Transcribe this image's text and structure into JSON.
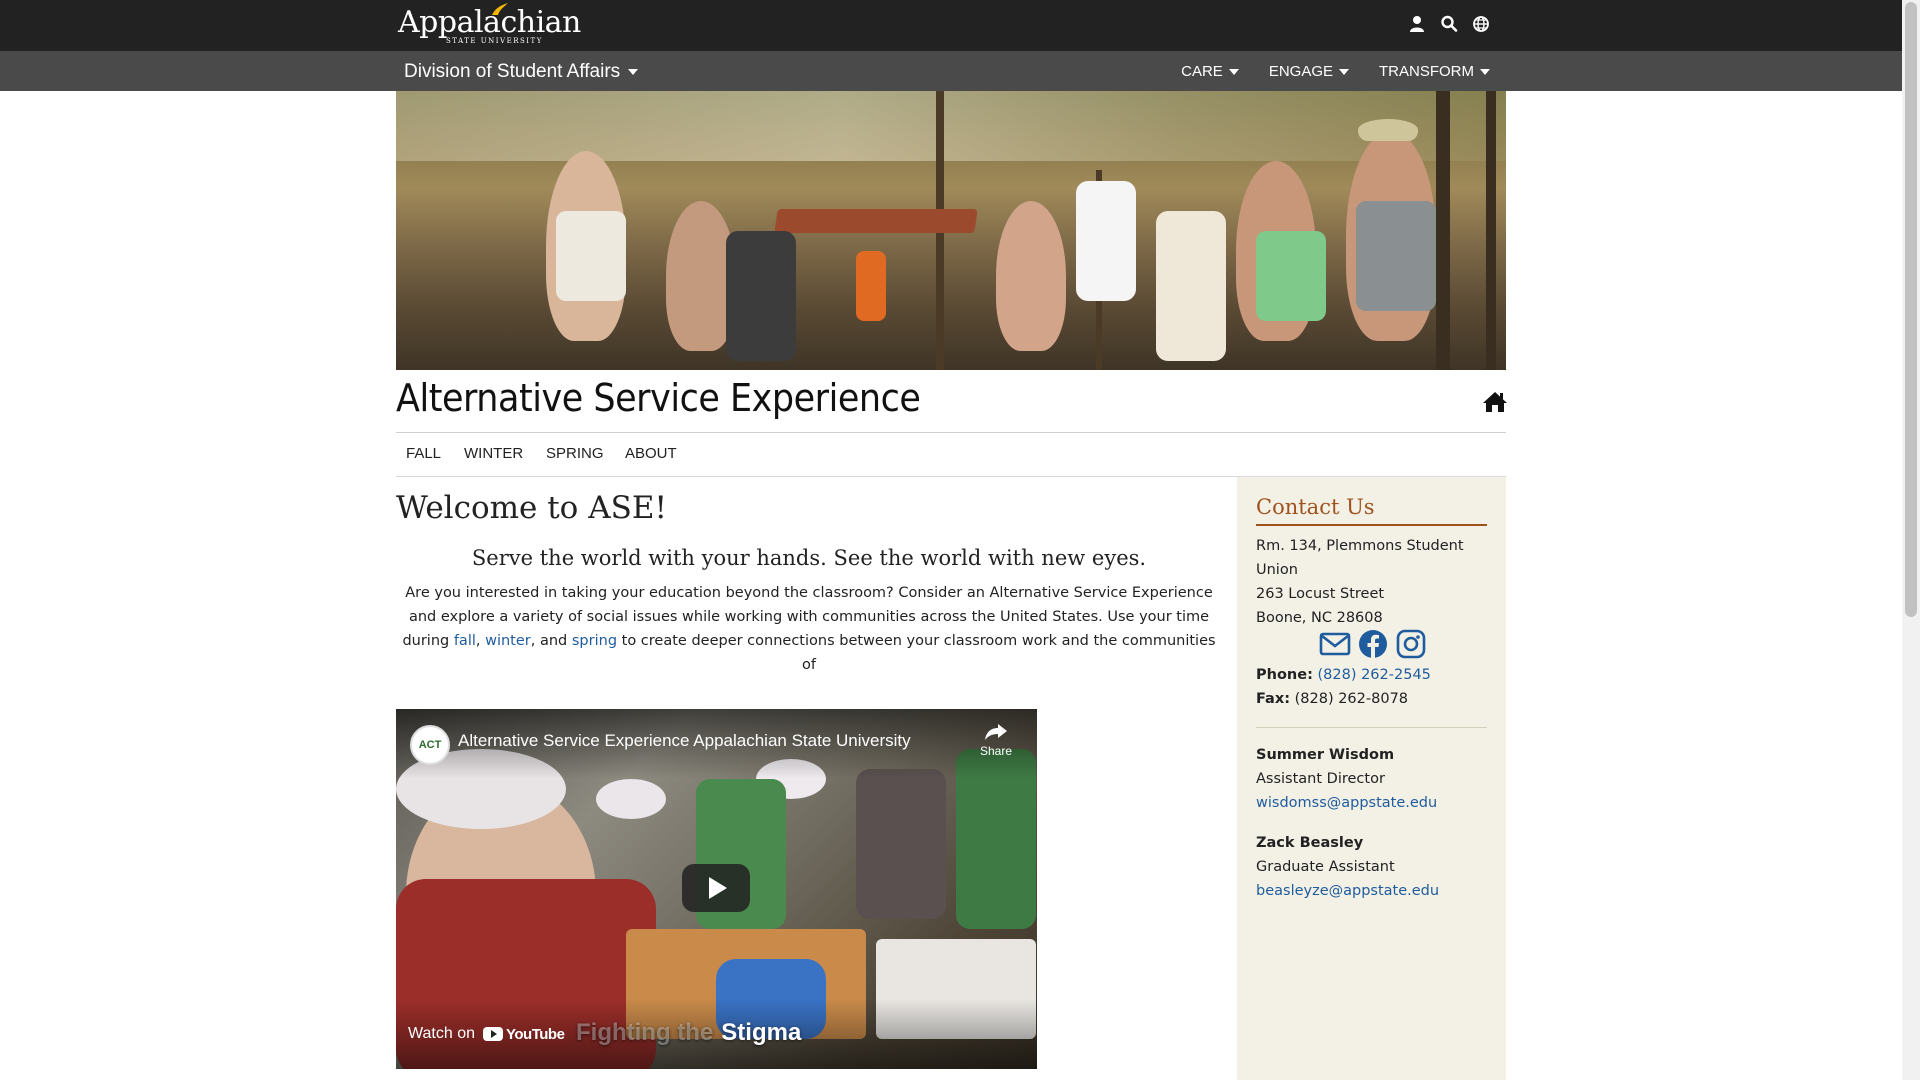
{
  "header": {
    "logo_text": "Appalachian",
    "logo_sub": "STATE UNIVERSITY",
    "icons": [
      "user-icon",
      "search-icon",
      "globe-icon"
    ]
  },
  "division_nav": {
    "title": "Division of Student Affairs",
    "menu": [
      "CARE",
      "ENGAGE",
      "TRANSFORM"
    ]
  },
  "site": {
    "title": "Alternative Service Experience",
    "subnav": [
      "FALL",
      "WINTER",
      "SPRING",
      "ABOUT"
    ]
  },
  "main": {
    "welcome": "Welcome to ASE!",
    "tagline": "Serve the world with your hands. See the world with new eyes.",
    "intro_part1": "Are you interested in taking your education beyond the classroom? Consider an Alternative Service Experience and explore a variety of social issues while working with communities across the United States. Use your time during ",
    "intro_link_fall": "fall",
    "intro_sep1": ", ",
    "intro_link_winter": "winter",
    "intro_sep2": ", and ",
    "intro_link_spring": "spring",
    "intro_part2": " to create deeper connections between your classroom work and the communities of"
  },
  "video": {
    "channel_avatar": "ACT",
    "title": "Alternative Service Experience Appalachian State University",
    "share_label": "Share",
    "watch_on": "Watch on",
    "youtube": "YouTube",
    "caption_dim": "Fighting the",
    "caption": "Stigma"
  },
  "sidebar": {
    "title": "Contact Us",
    "address_line1": "Rm. 134, Plemmons Student",
    "address_line2": "Union",
    "address_line3": "263 Locust Street",
    "address_line4": "Boone, NC 28608",
    "social_icons": [
      "mail-icon",
      "facebook-icon",
      "instagram-icon"
    ],
    "phone_label": "Phone:",
    "phone": "(828) 262-2545",
    "fax_label": "Fax:",
    "fax": "(828) 262-8078",
    "contacts": [
      {
        "name": "Summer Wisdom",
        "role": "Assistant Director",
        "email": "wisdomss@appstate.edu"
      },
      {
        "name": "Zack Beasley",
        "role": "Graduate Assistant",
        "email": "beasleyze@appstate.edu"
      }
    ]
  },
  "colors": {
    "topbar": "#222222",
    "divbar": "#4a4a4a",
    "accent": "#a0521d",
    "link": "#1f5c9e",
    "sidebar_bg": "#f3f0e6"
  }
}
